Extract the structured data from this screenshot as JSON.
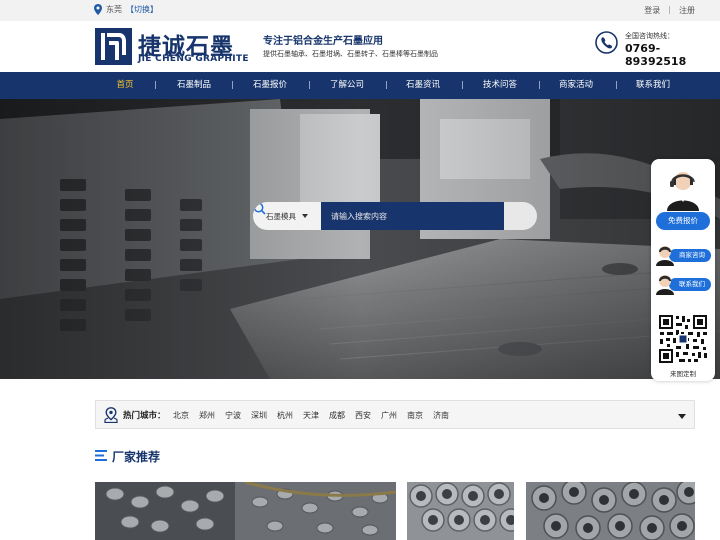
{
  "topbar": {
    "city": "东莞",
    "switch_label": "【切换】",
    "login": "登录",
    "separator": "|",
    "register": "注册"
  },
  "header": {
    "logo_cn": "捷诚石墨",
    "logo_en": "JIE CHENG GRAPHITE",
    "slogan": "专注于铝合金生产石墨应用",
    "products": "提供石墨轴承、石墨坩埚、石墨转子、石墨棒等石墨制品",
    "hotline_label": "全国咨询热线：",
    "hotline_number": "0769-89392518"
  },
  "nav": {
    "items": [
      {
        "label": "首页"
      },
      {
        "label": "石墨制品"
      },
      {
        "label": "石墨报价"
      },
      {
        "label": "了解公司"
      },
      {
        "label": "石墨资讯"
      },
      {
        "label": "技术问答"
      },
      {
        "label": "商家活动"
      },
      {
        "label": "联系我们"
      }
    ],
    "active_index": 0
  },
  "search": {
    "category": "石墨模具",
    "placeholder": "请输入搜索内容"
  },
  "float_bar": {
    "price_button": "免费报价",
    "consult_button": "商家咨询",
    "contact_button": "联系我们",
    "qr_label": "来图定制"
  },
  "cities": {
    "label": "热门城市：",
    "list": [
      "北京",
      "郑州",
      "宁波",
      "深圳",
      "杭州",
      "天津",
      "成都",
      "西安",
      "广州",
      "南京",
      "济南"
    ]
  },
  "section": {
    "title": "厂家推荐"
  },
  "colors": {
    "brand_navy": "#17356c",
    "accent_blue": "#1e6fd9",
    "active_nav": "#f6c22b"
  }
}
